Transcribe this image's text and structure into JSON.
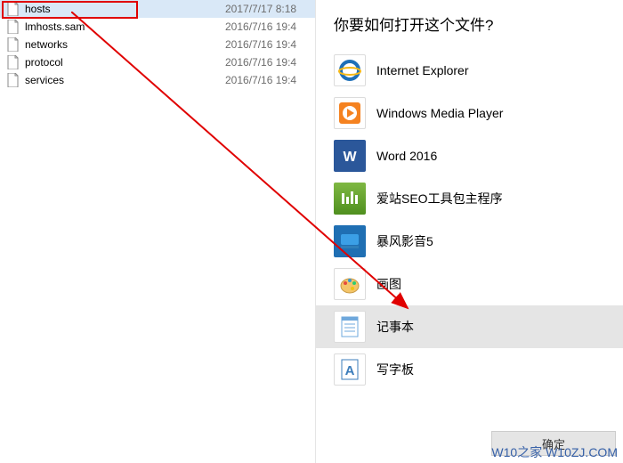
{
  "files": [
    {
      "name": "hosts",
      "date": "2017/7/17 8:18",
      "selected": true
    },
    {
      "name": "lmhosts.sam",
      "date": "2016/7/16 19:4",
      "selected": false
    },
    {
      "name": "networks",
      "date": "2016/7/16 19:4",
      "selected": false
    },
    {
      "name": "protocol",
      "date": "2016/7/16 19:4",
      "selected": false
    },
    {
      "name": "services",
      "date": "2016/7/16 19:4",
      "selected": false
    }
  ],
  "dialog": {
    "title": "你要如何打开这个文件?",
    "ok_label": "确定",
    "apps": [
      {
        "label": "Internet Explorer",
        "icon": "ie-icon",
        "selected": false
      },
      {
        "label": "Windows Media Player",
        "icon": "wmp-icon",
        "selected": false
      },
      {
        "label": "Word 2016",
        "icon": "word-icon",
        "selected": false
      },
      {
        "label": "爱站SEO工具包主程序",
        "icon": "seo-icon",
        "selected": false
      },
      {
        "label": "暴风影音5",
        "icon": "storm-icon",
        "selected": false
      },
      {
        "label": "画图",
        "icon": "paint-icon",
        "selected": false
      },
      {
        "label": "记事本",
        "icon": "notepad-icon",
        "selected": true
      },
      {
        "label": "写字板",
        "icon": "wordpad-icon",
        "selected": false
      }
    ]
  },
  "watermark": "W10之家 W10ZJ.COM"
}
